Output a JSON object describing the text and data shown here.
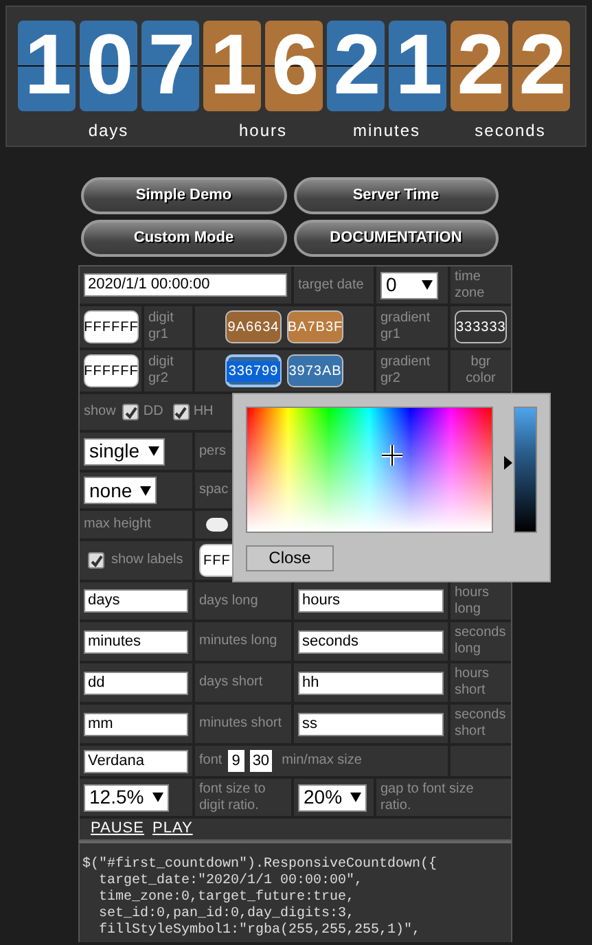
{
  "counter": {
    "groups": [
      {
        "digits": "107",
        "label": "days",
        "color": "#3571a9"
      },
      {
        "digits": "16",
        "label": "hours",
        "color": "#ad7338"
      },
      {
        "digits": "21",
        "label": "minutes",
        "color": "#3571a9"
      },
      {
        "digits": "22",
        "label": "seconds",
        "color": "#ad7338"
      }
    ]
  },
  "buttons": [
    "Simple Demo",
    "Server Time",
    "Custom Mode",
    "DOCUMENTATION"
  ],
  "settings": {
    "rows": [
      [
        {
          "kind": "input",
          "value": "2020/1/1 00:00:00"
        },
        {
          "kind": "label",
          "text": "target date"
        },
        {
          "kind": "select",
          "value": "0"
        },
        {
          "kind": "label",
          "text": "time zone"
        }
      ],
      [
        {
          "kind": "swatch",
          "text": "FFFFFF",
          "color": "#ffffff"
        },
        {
          "kind": "label",
          "text": "digit gr1"
        },
        {
          "kind": "swatch_pair",
          "swatches": [
            {
              "text": "9A6634",
              "color": "#9a6634",
              "selected": false
            },
            {
              "text": "BA7B3F",
              "color": "#ba7b3f",
              "selected": false
            }
          ]
        },
        {
          "kind": "label",
          "text": "gradient gr1"
        },
        {
          "kind": "swatch",
          "text": "333333",
          "color": "#333333"
        }
      ],
      [
        {
          "kind": "swatch",
          "text": "FFFFFF",
          "color": "#ffffff"
        },
        {
          "kind": "label",
          "text": "digit gr2"
        },
        {
          "kind": "swatch_pair",
          "swatches": [
            {
              "text": "336799",
              "color": "#336799",
              "selected": true
            },
            {
              "text": "3973AB",
              "color": "#3973ab",
              "selected": false
            }
          ]
        },
        {
          "kind": "label",
          "text": "gradient gr2"
        },
        {
          "kind": "label",
          "text": "bgr color"
        }
      ],
      [
        {
          "kind": "show_checks",
          "text": "show",
          "checks": [
            {
              "label": "DD",
              "checked": true
            },
            {
              "label": "HH",
              "checked": true
            }
          ]
        }
      ],
      [
        {
          "kind": "select",
          "value": "single"
        },
        {
          "kind": "label",
          "text": "pers"
        }
      ],
      [
        {
          "kind": "select",
          "value": "none"
        },
        {
          "kind": "label",
          "text": "spac"
        }
      ],
      [
        {
          "kind": "label",
          "text": "max height"
        },
        {
          "kind": "toggle",
          "on": false
        }
      ],
      [
        {
          "kind": "checkbox",
          "label": "show labels",
          "checked": true
        },
        {
          "kind": "swatch",
          "text": "FFF",
          "color": "#ffffff"
        }
      ],
      [
        {
          "kind": "input",
          "value": "days"
        },
        {
          "kind": "label",
          "text": "days long"
        },
        {
          "kind": "input",
          "value": "hours"
        },
        {
          "kind": "label",
          "text": "hours long"
        }
      ],
      [
        {
          "kind": "input",
          "value": "minutes"
        },
        {
          "kind": "label",
          "text": "minutes long"
        },
        {
          "kind": "input",
          "value": "seconds"
        },
        {
          "kind": "label",
          "text": "seconds long"
        }
      ],
      [
        {
          "kind": "input",
          "value": "dd"
        },
        {
          "kind": "label",
          "text": "days short"
        },
        {
          "kind": "input",
          "value": "hh"
        },
        {
          "kind": "label",
          "text": "hours short"
        }
      ],
      [
        {
          "kind": "input",
          "value": "mm"
        },
        {
          "kind": "label",
          "text": "minutes short"
        },
        {
          "kind": "input",
          "value": "ss"
        },
        {
          "kind": "label",
          "text": "seconds short"
        }
      ],
      [
        {
          "kind": "input",
          "value": "Verdana"
        },
        {
          "kind": "font_sizes",
          "label": "font",
          "min": "9",
          "max": "30",
          "suffix": "min/max size"
        },
        {
          "kind": "empty"
        }
      ],
      [
        {
          "kind": "select",
          "value": "12.5%"
        },
        {
          "kind": "label",
          "text": "font size to digit ratio."
        },
        {
          "kind": "select",
          "value": "20%"
        },
        {
          "kind": "label",
          "text": "gap to font size ratio."
        }
      ],
      [
        {
          "kind": "links",
          "items": [
            "PAUSE",
            "PLAY"
          ]
        }
      ]
    ]
  },
  "popup": {
    "kind": "color_picker",
    "close_label": "Close"
  },
  "code": [
    "$(\"#first_countdown\").ResponsiveCountdown({",
    "  target_date:\"2020/1/1 00:00:00\",",
    "  time_zone:0,target_future:true,",
    "  set_id:0,pan_id:0,day_digits:3,",
    "  fillStyleSymbol1:\"rgba(255,255,255,1)\","
  ]
}
